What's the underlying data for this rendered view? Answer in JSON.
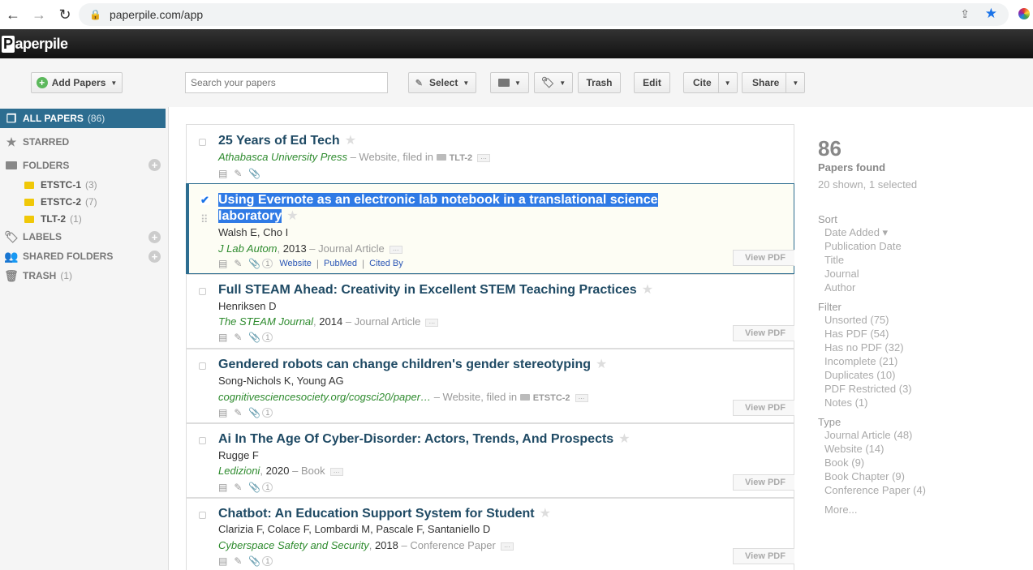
{
  "browser": {
    "url": "paperpile.com/app"
  },
  "app": {
    "logo_letter": "P",
    "logo_rest": "aperpile"
  },
  "toolbar": {
    "add_papers": "Add Papers",
    "search_placeholder": "Search your papers",
    "select": "Select",
    "trash": "Trash",
    "edit": "Edit",
    "cite": "Cite",
    "share": "Share"
  },
  "sidebar": {
    "all_papers": {
      "label": "ALL PAPERS",
      "count": "(86)"
    },
    "starred": "STARRED",
    "folders": "FOLDERS",
    "folder_items": [
      {
        "label": "ETSTC-1",
        "count": "(3)"
      },
      {
        "label": "ETSTC-2",
        "count": "(7)"
      },
      {
        "label": "TLT-2",
        "count": "(1)"
      }
    ],
    "labels": "LABELS",
    "shared_folders": "SHARED FOLDERS",
    "trash": {
      "label": "TRASH",
      "count": "(1)"
    }
  },
  "papers": [
    {
      "title": "25 Years of Ed Tech",
      "authors": "",
      "journal": "Athabasca University Press",
      "year": "",
      "type": "Website, filed in",
      "folder": "TLT-2",
      "links": []
    },
    {
      "title": "Using Evernote as an electronic lab notebook in a translational science laboratory",
      "title_line1": "Using Evernote as an electronic lab notebook in a translational science",
      "title_line2": "laboratory",
      "authors": "Walsh E, Cho I",
      "journal": "J Lab Autom",
      "year": "2013",
      "type": "Journal Article",
      "attachments": "1",
      "links": [
        "Website",
        "PubMed",
        "Cited By"
      ],
      "selected": true
    },
    {
      "title": "Full STEAM Ahead: Creativity in Excellent STEM Teaching Practices",
      "authors": "Henriksen D",
      "journal": "The STEAM Journal",
      "year": "2014",
      "type": "Journal Article",
      "attachments": "1"
    },
    {
      "title": "Gendered robots can change children's gender stereotyping",
      "authors": "Song-Nichols K, Young AG",
      "journal": "cognitivesciencesociety.org/cogsci20/paper…",
      "year": "",
      "type": "Website, filed in",
      "folder": "ETSTC-2",
      "attachments": "1"
    },
    {
      "title": "Ai In The Age Of Cyber-Disorder: Actors, Trends, And Prospects",
      "authors": "Rugge F",
      "journal": "Ledizioni",
      "year": "2020",
      "type": "Book",
      "attachments": "1"
    },
    {
      "title": "Chatbot: An Education Support System for Student",
      "authors": "Clarizia F, Colace F, Lombardi M, Pascale F, Santaniello D",
      "journal": "Cyberspace Safety and Security",
      "year": "2018",
      "type": "Conference Paper",
      "attachments": "1"
    }
  ],
  "view_pdf": "View PDF",
  "summary": {
    "count": "86",
    "found": "Papers found",
    "shown": "20 shown, 1 selected"
  },
  "sort": {
    "heading": "Sort",
    "options": [
      "Date Added ▾",
      "Publication Date",
      "Title",
      "Journal",
      "Author"
    ]
  },
  "filter": {
    "heading": "Filter",
    "options": [
      "Unsorted (75)",
      "Has PDF (54)",
      "Has no PDF (32)",
      "Incomplete (21)",
      "Duplicates (10)",
      "PDF Restricted (3)",
      "Notes (1)"
    ]
  },
  "type": {
    "heading": "Type",
    "options": [
      "Journal Article (48)",
      "Website (14)",
      "Book (9)",
      "Book Chapter (9)",
      "Conference Paper (4)"
    ],
    "more": "More..."
  },
  "colors": {
    "accent": "#2d6d90",
    "journal_green": "#2e8b2e",
    "title_blue": "#1f4a64",
    "selection": "#2f7ae5"
  }
}
